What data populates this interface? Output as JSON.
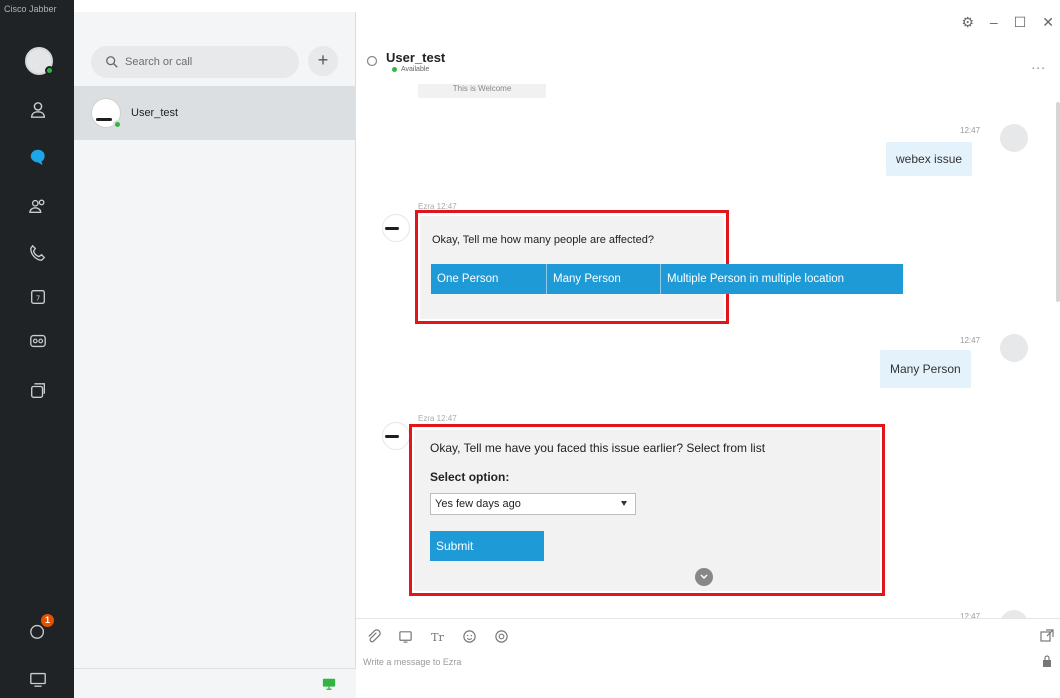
{
  "app": {
    "title": "Cisco Jabber"
  },
  "search": {
    "placeholder": "Search or call"
  },
  "add_button": {
    "label": "+"
  },
  "contacts": [
    {
      "name": "User_test",
      "presence": "available"
    }
  ],
  "chat": {
    "title": "User_test",
    "status": "Available",
    "more": "...",
    "window_controls": {
      "settings": "⚙",
      "minimize": "–",
      "maximize": "☐",
      "close": "✕"
    },
    "cut_text": "This is Welcome",
    "messages": [
      {
        "time": "12:47",
        "text": "webex issue"
      },
      {
        "bot_meta": "Ezra 12:47",
        "question": "Okay, Tell me how many people are affected?",
        "options": [
          "One Person",
          "Many Person",
          "Multiple Person in multiple location"
        ]
      },
      {
        "time": "12:47",
        "text": "Many Person"
      },
      {
        "bot_meta": "Ezra 12:47",
        "question": "Okay, Tell me have you faced this issue earlier? Select from list",
        "select_label": "Select option:",
        "selected": "Yes few days ago",
        "submit": "Submit"
      },
      {
        "time": "12:47"
      }
    ]
  },
  "compose": {
    "placeholder": "Write a message to Ezra"
  },
  "colors": {
    "accent": "#1e9ad6",
    "highlight": "#e0161b",
    "rail": "#1f2326",
    "presence": "#33b344",
    "badge": "#e65100"
  },
  "rail": {
    "icons": [
      "contacts-icon",
      "chats-icon",
      "meetings-icon",
      "calls-icon",
      "calendar-icon",
      "voicemail-icon",
      "custom-tab-icon"
    ],
    "badge_count": "1"
  }
}
